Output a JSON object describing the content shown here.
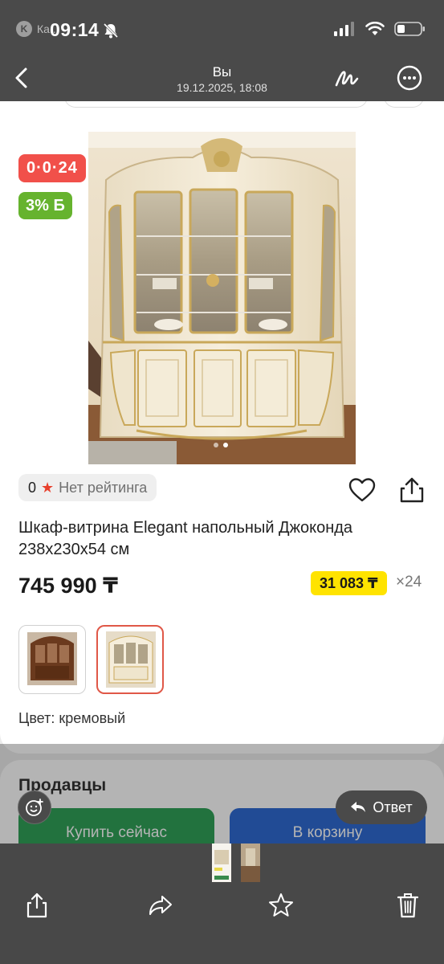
{
  "status_bar": {
    "app_label": "Ка...",
    "time": "09:14"
  },
  "nav": {
    "title": "Вы",
    "subtitle": "19.12.2025, 18:08"
  },
  "product": {
    "installment_badge": "0·0·24",
    "bonus_badge": "3% Б",
    "rating_count": "0",
    "rating_text": "Нет рейтинга",
    "title": "Шкаф-витрина Elegant напольный Джоконда 238x230x54 см",
    "price": "745 990 ₸",
    "monthly_payment": "31 083 ₸",
    "months": "×24",
    "color_label": "Цвет: кремовый",
    "photo_count": 2,
    "current_photo": 2
  },
  "sellers": {
    "title": "Продавцы",
    "buy_now": "Купить сейчас",
    "add_to_cart": "В корзину"
  },
  "chat": {
    "reply_label": "Ответ"
  },
  "colors": {
    "installment": "#f1504a",
    "bonus": "#66b32e",
    "monthly": "#ffe300",
    "buy": "#1f9a4b",
    "cart": "#1e5fcf"
  },
  "icons": [
    "back-icon",
    "draw-icon",
    "more-icon",
    "heart-icon",
    "share-icon",
    "smile-icon",
    "reply-arrow-icon",
    "share-out-icon",
    "forward-icon",
    "star-icon",
    "trash-icon"
  ]
}
